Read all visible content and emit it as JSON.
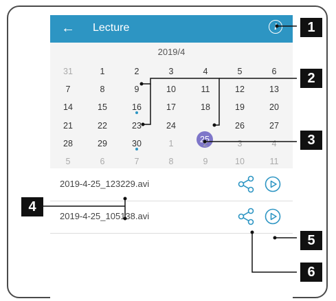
{
  "header": {
    "back_icon": "arrow-left-icon",
    "title": "Lecture",
    "info_icon": "info-icon"
  },
  "calendar": {
    "month": "2019/4",
    "weeks": [
      [
        "31",
        "1",
        "2",
        "3",
        "4",
        "5",
        "6"
      ],
      [
        "7",
        "8",
        "9",
        "10",
        "11",
        "12",
        "13"
      ],
      [
        "14",
        "15",
        "16",
        "17",
        "18",
        "19",
        "20"
      ],
      [
        "21",
        "22",
        "23",
        "24",
        "25",
        "26",
        "27"
      ],
      [
        "28",
        "29",
        "30",
        "1",
        "2",
        "3",
        "4"
      ],
      [
        "5",
        "6",
        "7",
        "8",
        "9",
        "10",
        "11"
      ]
    ],
    "selected_day": "25"
  },
  "recordings": [
    {
      "file": "2019-4-25_123229.avi",
      "share_icon": "share-icon",
      "play_icon": "play-icon"
    },
    {
      "file": "2019-4-25_105138.avi",
      "share_icon": "share-icon",
      "play_icon": "play-icon"
    }
  ],
  "callouts": [
    "1",
    "2",
    "3",
    "4",
    "5",
    "6"
  ],
  "colors": {
    "header": "#2d95c3",
    "selected_day": "#7e76c9",
    "event_dot": "#2d95c3",
    "icon": "#2d95c3"
  }
}
